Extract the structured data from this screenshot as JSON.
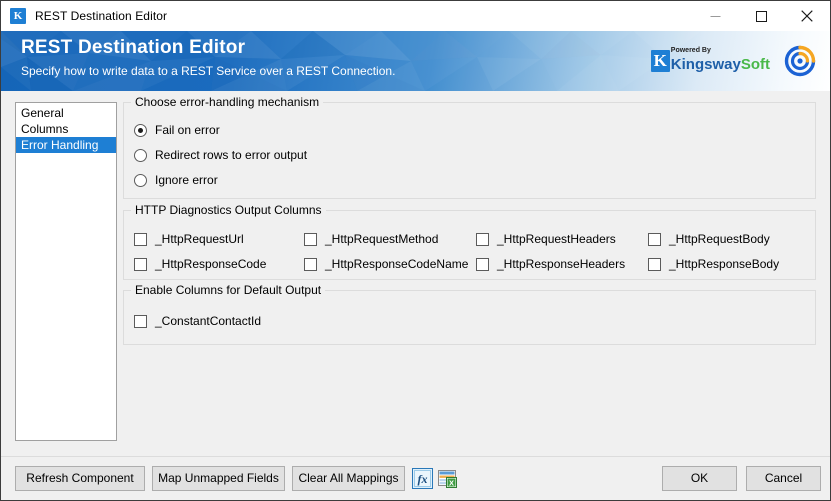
{
  "window": {
    "title": "REST Destination Editor",
    "app_icon": "kingswaysoft-k-icon",
    "controls": {
      "minimize": "minimize-icon",
      "maximize": "maximize-icon",
      "close": "close-icon"
    }
  },
  "banner": {
    "title": "REST Destination Editor",
    "subtitle": "Specify how to write data to a REST Service over a REST Connection.",
    "logo": {
      "powered_by": "Powered By",
      "brand_first": "Kingsway",
      "brand_second": "Soft",
      "mark": "kingswaysoft-target-logo"
    },
    "colors": {
      "blue": "#1565b8",
      "brand_blue": "#1e5fa8",
      "brand_green": "#49b849",
      "mark_blue": "#1b62d4",
      "mark_orange": "#f5a623"
    }
  },
  "sidebar": {
    "items": [
      {
        "label": "General",
        "selected": false
      },
      {
        "label": "Columns",
        "selected": false
      },
      {
        "label": "Error Handling",
        "selected": true
      }
    ],
    "selected_color": "#1e7fd4"
  },
  "error_handling": {
    "legend": "Choose error-handling mechanism",
    "options": [
      {
        "label": "Fail on error",
        "checked": true
      },
      {
        "label": "Redirect rows to error output",
        "checked": false
      },
      {
        "label": "Ignore error",
        "checked": false
      }
    ]
  },
  "http_diagnostics": {
    "legend": "HTTP Diagnostics Output Columns",
    "columns": [
      [
        {
          "label": "_HttpRequestUrl",
          "checked": false
        },
        {
          "label": "_HttpResponseCode",
          "checked": false
        }
      ],
      [
        {
          "label": "_HttpRequestMethod",
          "checked": false
        },
        {
          "label": "_HttpResponseCodeName",
          "checked": false
        }
      ],
      [
        {
          "label": "_HttpRequestHeaders",
          "checked": false
        },
        {
          "label": "_HttpResponseHeaders",
          "checked": false
        }
      ],
      [
        {
          "label": "_HttpRequestBody",
          "checked": false
        },
        {
          "label": "_HttpResponseBody",
          "checked": false
        }
      ]
    ]
  },
  "default_output": {
    "legend": "Enable Columns for Default Output",
    "items": [
      {
        "label": "_ConstantContactId",
        "checked": false
      }
    ]
  },
  "footer": {
    "refresh_component": "Refresh Component",
    "map_unmapped_fields": "Map Unmapped Fields",
    "clear_all_mappings": "Clear All Mappings",
    "fx_button": "fx-icon",
    "grid_button": "export-grid-icon",
    "ok": "OK",
    "cancel": "Cancel"
  }
}
